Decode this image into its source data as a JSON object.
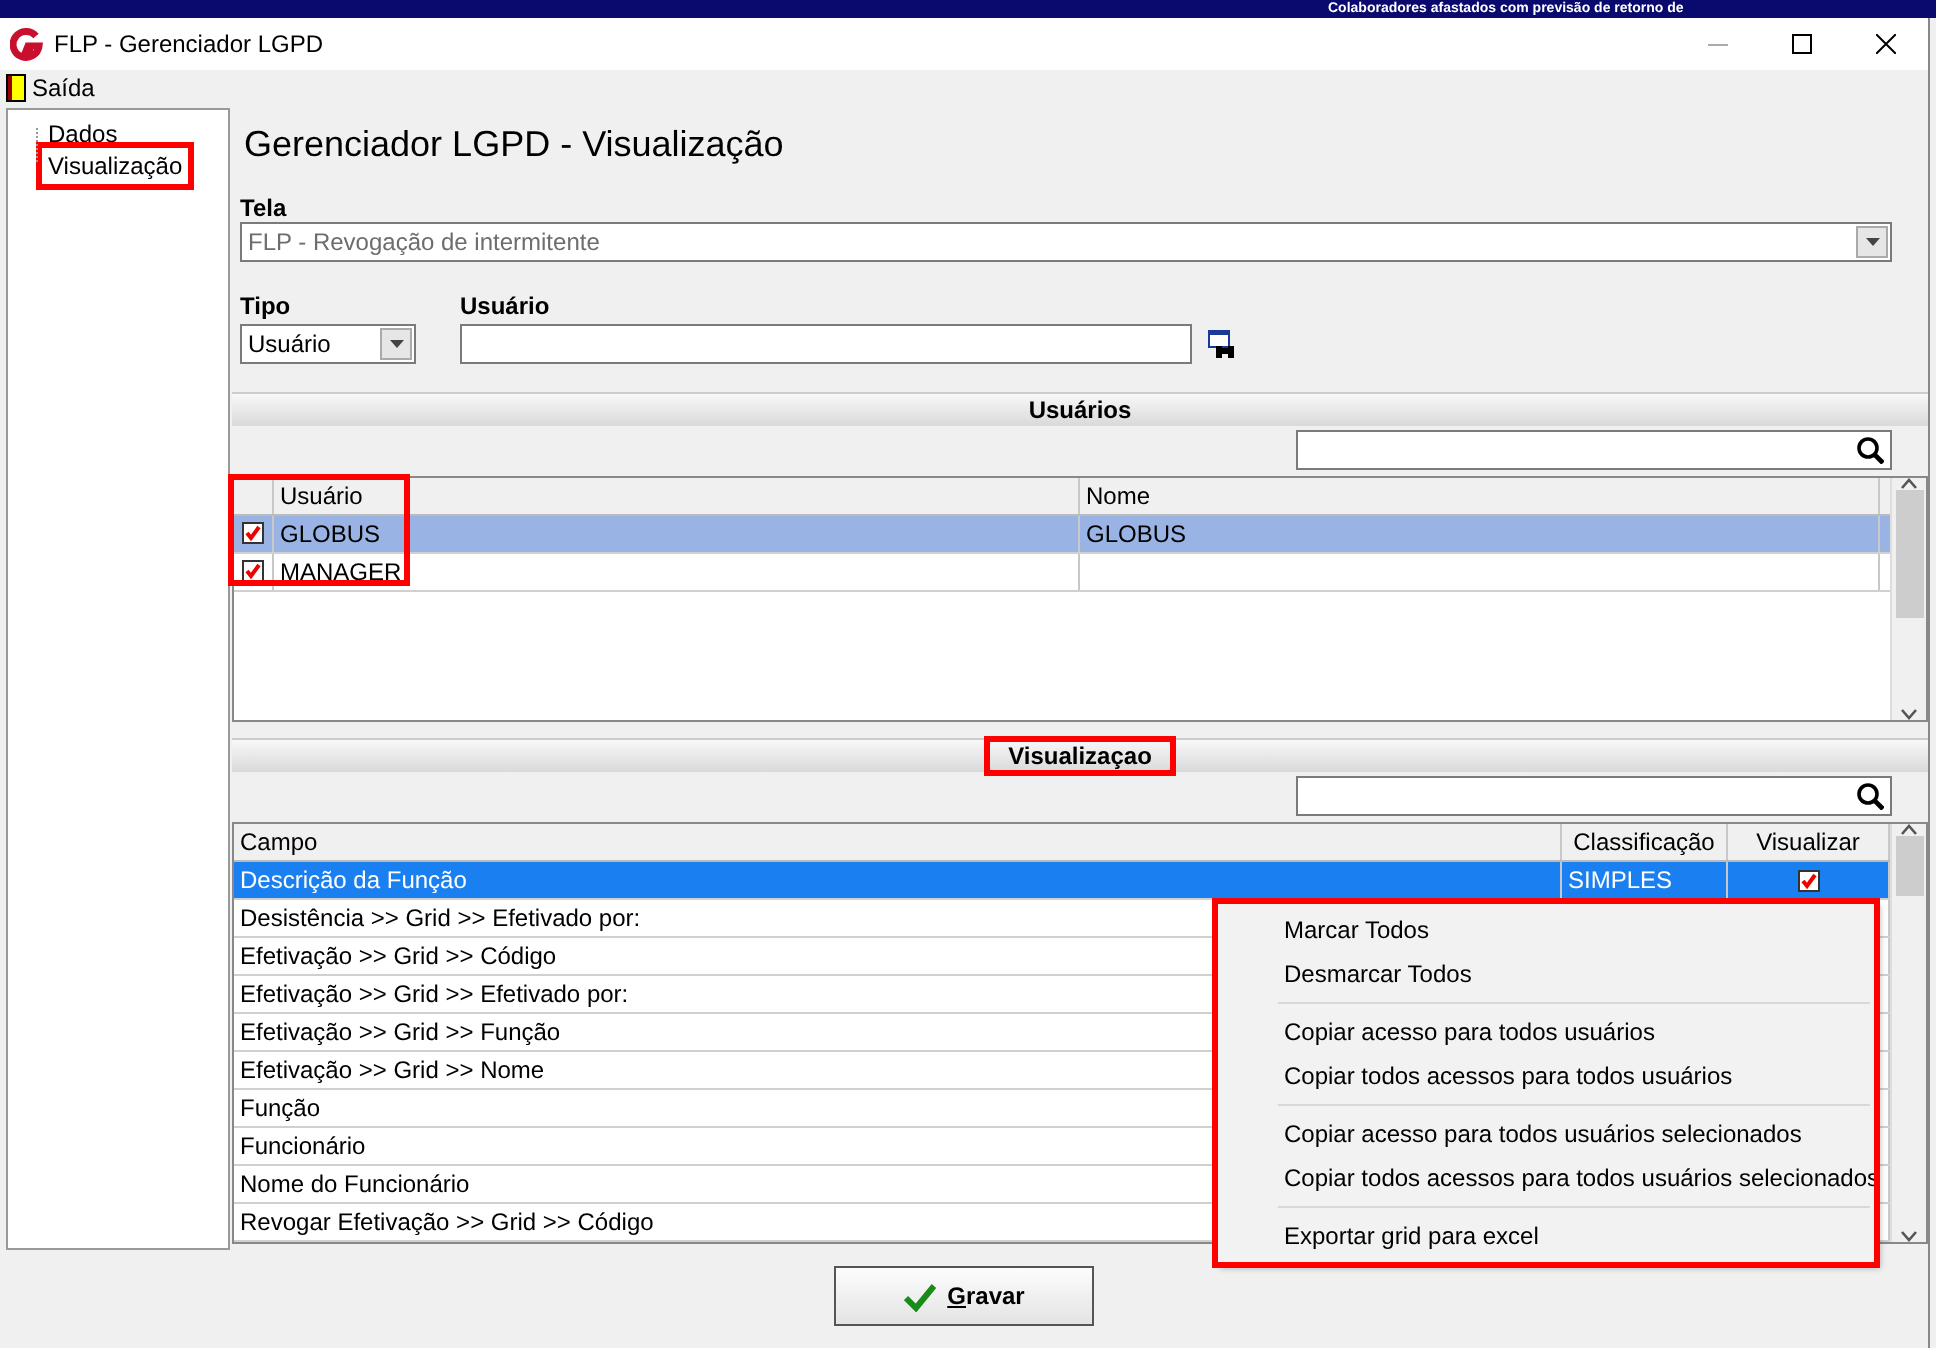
{
  "background_window": {
    "title": "Colaboradores afastados com previsão de retorno de"
  },
  "window": {
    "title": "FLP - Gerenciador LGPD"
  },
  "menu": [
    {
      "label": "Saída"
    }
  ],
  "tree": [
    {
      "label": "Dados",
      "selected": false,
      "highlighted": false
    },
    {
      "label": "Visualização",
      "selected": false,
      "highlighted": true
    }
  ],
  "heading": "Gerenciador LGPD - Visualização",
  "tela": {
    "label": "Tela",
    "value": "FLP - Revogação de intermitente",
    "disabled": true
  },
  "tipo": {
    "label": "Tipo",
    "value": "Usuário"
  },
  "usuario": {
    "label": "Usuário"
  },
  "users": {
    "title": "Usuários",
    "title_highlighted": false,
    "check_column_highlighted": true,
    "columns": [
      "Usuário",
      "Nome"
    ],
    "rows": [
      {
        "usuario": "GLOBUS",
        "nome": "GLOBUS",
        "checked": true,
        "selected": true
      },
      {
        "usuario": "MANAGER",
        "checked": true,
        "selected": false
      }
    ]
  },
  "visualizacao": {
    "title": "Visualizaçao",
    "title_highlighted": true,
    "columns": [
      "Campo",
      "Classificação",
      "Visualizar"
    ],
    "rows": [
      {
        "campo": "Descrição da Função",
        "classificacao": "SIMPLES",
        "visualizar": true,
        "selected": true
      },
      {
        "campo": "Desistência >> Grid >> Efetivado por:",
        "selected": false
      },
      {
        "campo": "Efetivação >> Grid >> Código",
        "selected": false
      },
      {
        "campo": "Efetivação >> Grid >> Efetivado por:",
        "selected": false
      },
      {
        "campo": "Efetivação >> Grid >> Função",
        "selected": false
      },
      {
        "campo": "Efetivação >> Grid >> Nome",
        "selected": false
      },
      {
        "campo": "Função",
        "selected": false
      },
      {
        "campo": "Funcionário",
        "selected": false
      },
      {
        "campo": "Nome do Funcionário",
        "selected": false
      },
      {
        "campo": "Revogar Efetivação >> Grid >> Código",
        "selected": false
      }
    ]
  },
  "context_menu": {
    "highlighted": true,
    "groups": [
      [
        "Marcar Todos",
        "Desmarcar Todos"
      ],
      [
        "Copiar acesso para todos usuários",
        "Copiar todos acessos para todos usuários"
      ],
      [
        "Copiar acesso para todos usuários selecionados",
        "Copiar todos acessos para todos usuários selecionados"
      ],
      [
        "Exportar grid para excel"
      ]
    ]
  },
  "save_button": {
    "label": "Gravar"
  }
}
